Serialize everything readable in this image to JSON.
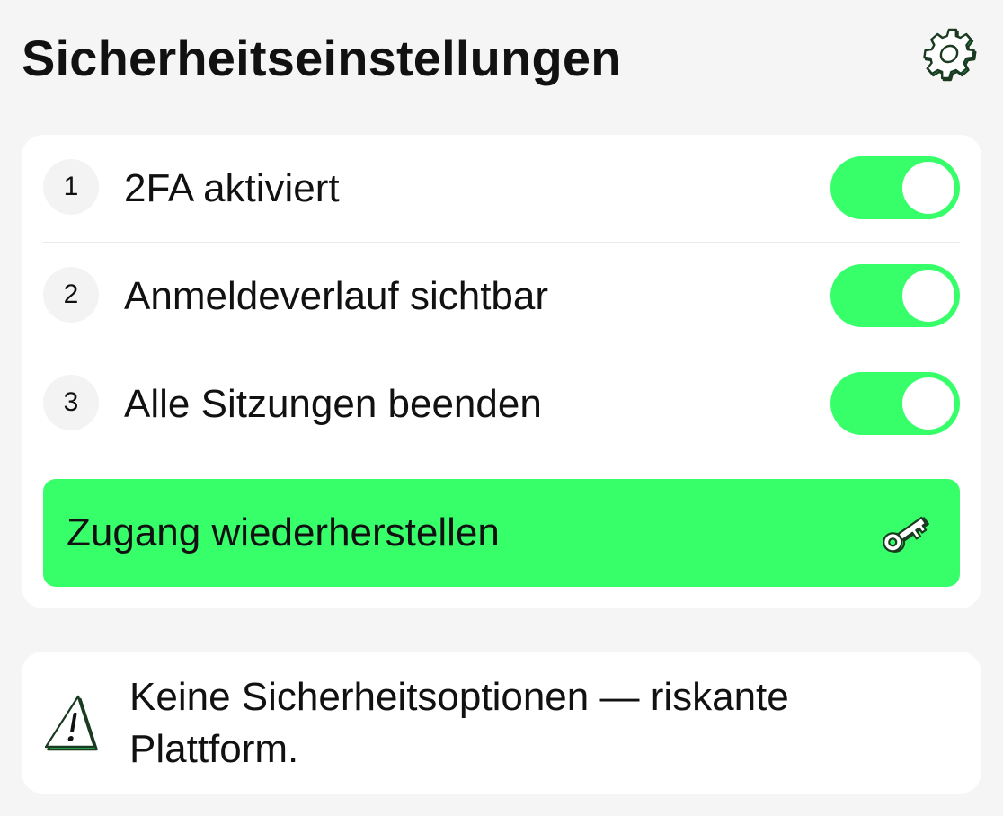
{
  "header": {
    "title": "Sicherheitseinstellungen",
    "settings_icon": "gear-icon"
  },
  "settings": [
    {
      "number": "1",
      "label": "2FA aktiviert",
      "enabled": true
    },
    {
      "number": "2",
      "label": "Anmeldeverlauf sichtbar",
      "enabled": true
    },
    {
      "number": "3",
      "label": "Alle Sitzungen beenden",
      "enabled": true
    }
  ],
  "recover_button": {
    "label": "Zugang wiederherstellen",
    "icon": "key-icon"
  },
  "warning": {
    "icon": "alert-triangle-icon",
    "text": "Keine Sicherheitsoptionen — riskante Plattform."
  },
  "colors": {
    "accent": "#36ff6a",
    "background": "#f5f5f5",
    "card": "#ffffff",
    "icon_stroke": "#1a3a22"
  }
}
